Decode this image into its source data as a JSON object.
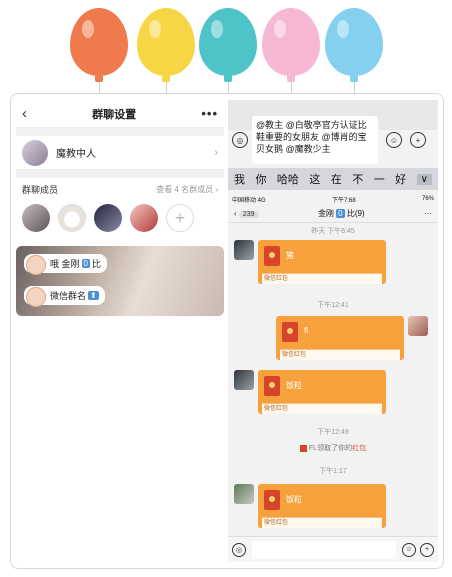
{
  "colors": {
    "balloon_orange": "#ef7a4b",
    "balloon_yellow": "#f7d646",
    "balloon_teal": "#4fc4c8",
    "balloon_pink": "#f6b8d2",
    "balloon_blue": "#86d0ef",
    "red_packet": "#f7a13c",
    "accent_blue": "#4a90d9"
  },
  "left": {
    "back_icon": "chevron-left-icon",
    "title": "群聊设置",
    "more_icon": "more-icon",
    "group_name": "魔教中人",
    "members_label": "群聊成员",
    "members_more": "查看 4 名群成员",
    "photo_bubble_1": {
      "text": "哦 金刚",
      "tag": "0",
      "suffix": "比"
    },
    "photo_bubble_2": {
      "text": "微信群名",
      "tag": "⬆"
    }
  },
  "right": {
    "composer_text": "@教主 @白敬亭官方认证比鞋重要的女朋友 @博肖的宝贝女鹅 @魔教少主",
    "candidates": [
      "我",
      "你",
      "哈哈",
      "这",
      "在",
      "不",
      "一",
      "好"
    ],
    "candidates_arrow": "∨",
    "status_left": "中国移动 4G",
    "status_time": "下午7:68",
    "status_right": "76%",
    "back_count": "239",
    "chat_title": "金刚",
    "chat_title_tag": "0",
    "chat_title_suffix": "比(9)",
    "chat_more": "···",
    "ts_1": "昨天 下午6:45",
    "ts_2": "下午12:41",
    "ts_3": "下午12:49",
    "ts_4": "下午1:17",
    "packet_label": "微信红包",
    "msg_1": "猪",
    "msg_2": "fl",
    "msg_3": "饭粒",
    "msg_4": "饭粒",
    "recv_text": "FL领取了你的",
    "recv_highlight": "红包"
  }
}
